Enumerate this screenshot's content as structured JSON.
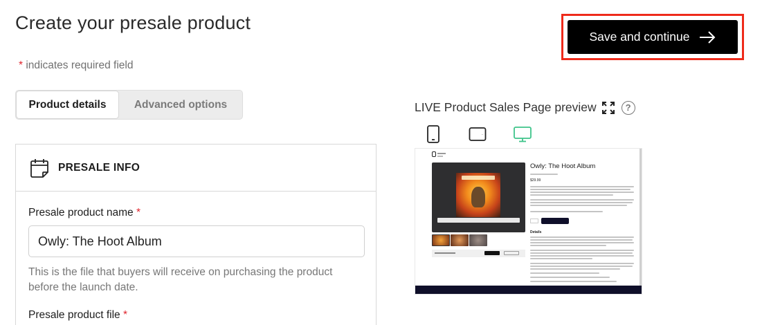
{
  "page": {
    "title": "Create your presale product",
    "required_star": "*",
    "required_note": " indicates required field"
  },
  "header": {
    "save_label": "Save and continue"
  },
  "tabs": [
    {
      "label": "Product details",
      "active": true
    },
    {
      "label": "Advanced options",
      "active": false
    }
  ],
  "presale_info": {
    "section_title": "PRESALE INFO",
    "name_label": "Presale product name",
    "name_required": "*",
    "name_value": "Owly: The Hoot Album",
    "helper_text": "This is the file that buyers will receive on purchasing the product before the launch date.",
    "file_label": "Presale product file",
    "file_required": "*"
  },
  "preview": {
    "title": "LIVE Product Sales Page preview",
    "help_glyph": "?",
    "devices": [
      "mobile-icon",
      "tablet-icon",
      "desktop-icon"
    ],
    "selected_device": "desktop",
    "product_title": "Owly: The Hoot Album",
    "price": "$29.99",
    "details_heading": "Details"
  },
  "colors": {
    "accent_red": "#e0242c",
    "highlight_border": "#ee2a1a",
    "button_bg": "#000000",
    "selected_device": "#3ec48a"
  }
}
